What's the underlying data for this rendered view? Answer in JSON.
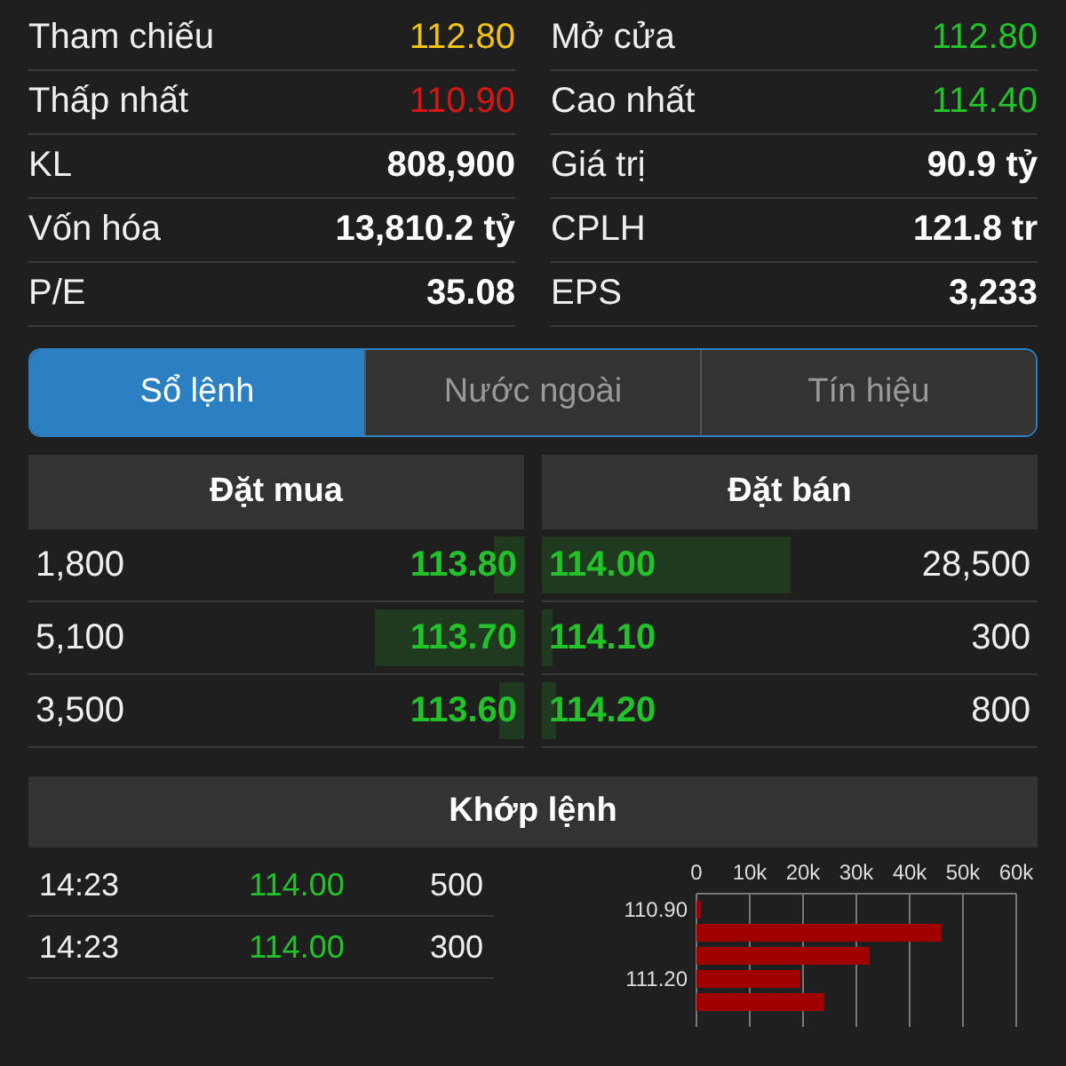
{
  "stats": [
    {
      "left": {
        "label": "Tham chiếu",
        "value": "112.80",
        "kind": "ref"
      },
      "right": {
        "label": "Mở cửa",
        "value": "112.80",
        "kind": "up"
      }
    },
    {
      "left": {
        "label": "Thấp nhất",
        "value": "110.90",
        "kind": "down"
      },
      "right": {
        "label": "Cao nhất",
        "value": "114.40",
        "kind": "up"
      }
    },
    {
      "left": {
        "label": "KL",
        "value": "808,900",
        "kind": "plain"
      },
      "right": {
        "label": "Giá trị",
        "value": "90.9 tỷ",
        "kind": "plain"
      }
    },
    {
      "left": {
        "label": "Vốn hóa",
        "value": "13,810.2 tỷ",
        "kind": "plain"
      },
      "right": {
        "label": "CPLH",
        "value": "121.8 tr",
        "kind": "plain"
      }
    },
    {
      "left": {
        "label": "P/E",
        "value": "35.08",
        "kind": "plain"
      },
      "right": {
        "label": "EPS",
        "value": "3,233",
        "kind": "plain"
      }
    }
  ],
  "tabs": [
    {
      "label": "Sổ lệnh",
      "selected": true
    },
    {
      "label": "Nước ngoài",
      "selected": false
    },
    {
      "label": "Tín hiệu",
      "selected": false
    }
  ],
  "order_book": {
    "buy_header": "Đặt mua",
    "sell_header": "Đặt bán",
    "rows": [
      {
        "buy": {
          "volume": "1,800",
          "price": "113.80",
          "level": 0.06
        },
        "sell": {
          "price": "114.00",
          "level": 0.5,
          "volume": "28,500"
        }
      },
      {
        "buy": {
          "volume": "5,100",
          "price": "113.70",
          "level": 0.3
        },
        "sell": {
          "price": "114.10",
          "level": 0.02,
          "volume": "300"
        }
      },
      {
        "buy": {
          "volume": "3,500",
          "price": "113.60",
          "level": 0.05
        },
        "sell": {
          "price": "114.20",
          "level": 0.03,
          "volume": "800"
        }
      }
    ]
  },
  "matched": {
    "header": "Khớp lệnh",
    "trades": [
      {
        "time": "14:23",
        "price": "114.00",
        "kind": "up",
        "volume": "500"
      },
      {
        "time": "14:23",
        "price": "114.00",
        "kind": "up",
        "volume": "300"
      }
    ],
    "chart_data": {
      "type": "bar",
      "orientation": "horizontal",
      "grid": true,
      "categories": [
        "110.90",
        null,
        null,
        "111.20",
        null
      ],
      "series": [
        {
          "color": "#a00000",
          "values": [
            800,
            46000,
            32500,
            19500,
            24000
          ]
        }
      ],
      "xlim": [
        0,
        60000
      ],
      "xticks": [
        {
          "value": 0,
          "label": "0"
        },
        {
          "value": 10000,
          "label": "10k"
        },
        {
          "value": 20000,
          "label": "20k"
        },
        {
          "value": 30000,
          "label": "30k"
        },
        {
          "value": 40000,
          "label": "40k"
        },
        {
          "value": 50000,
          "label": "50k"
        },
        {
          "value": 60000,
          "label": "60k"
        }
      ]
    }
  }
}
